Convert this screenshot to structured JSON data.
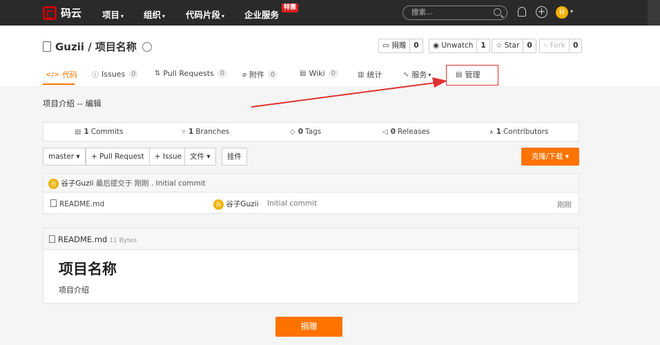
{
  "topnav": {
    "brand": "码云",
    "items": [
      {
        "label": "项目",
        "caret": "▾"
      },
      {
        "label": "组织",
        "caret": "▾"
      },
      {
        "label": "代码片段",
        "caret": "▾"
      },
      {
        "label": "企业服务",
        "caret": ""
      }
    ],
    "hot_badge": "特惠",
    "search_placeholder": "搜索...",
    "avatar_initial": "谷"
  },
  "repo": {
    "title": "Guzii / 项目名称",
    "actions": [
      {
        "label": "捐赠",
        "count": "0",
        "icon": "donate-icon"
      },
      {
        "label": "Unwatch",
        "count": "1",
        "icon": "eye-icon"
      },
      {
        "label": "Star",
        "count": "0",
        "icon": "star-icon"
      },
      {
        "label": "Fork",
        "count": "0",
        "icon": "fork-icon"
      }
    ],
    "tabs": [
      {
        "label": "代码",
        "icon": "</>",
        "count": ""
      },
      {
        "label": "Issues",
        "icon": "ⓘ",
        "count": "0"
      },
      {
        "label": "Pull Requests",
        "icon": "⇅",
        "count": "0"
      },
      {
        "label": "附件",
        "icon": "⌀",
        "count": "0"
      },
      {
        "label": "Wiki",
        "icon": "▤",
        "count": "0"
      },
      {
        "label": "统计",
        "icon": "▥",
        "count": ""
      },
      {
        "label": "服务",
        "icon": "∿",
        "count": ""
      },
      {
        "label": "管理",
        "icon": "▤",
        "count": ""
      }
    ]
  },
  "description": {
    "text": "项目介绍",
    "sep": " -- ",
    "edit": "编辑"
  },
  "stats": [
    {
      "count": "1",
      "label": "Commits",
      "icon": "▤"
    },
    {
      "count": "1",
      "label": "Branches",
      "icon": "⑂"
    },
    {
      "count": "0",
      "label": "Tags",
      "icon": "◇"
    },
    {
      "count": "0",
      "label": "Releases",
      "icon": "◁"
    },
    {
      "count": "1",
      "label": "Contributors",
      "icon": "⩚"
    }
  ],
  "toolbar": {
    "branch": "master ▾",
    "pull_request": "+ Pull Request",
    "issue": "+ Issue",
    "file": "文件 ▾",
    "widget": "挂件",
    "clone": "克隆/下载 ▾"
  },
  "commit": {
    "author": "谷子Guzii",
    "text": "最后提交于 刚刚 . Initial commit",
    "avatar_initial": "谷"
  },
  "files": [
    {
      "name": "README.md",
      "author": "谷子Guzii",
      "message": "Initial commit",
      "time": "刚刚"
    }
  ],
  "readme": {
    "file": "README.md",
    "size": "11 Bytes",
    "heading": "项目名称",
    "body": "项目介绍"
  },
  "donate_button": "捐赠",
  "colors": {
    "accent": "#fe7300",
    "nav_bg": "#2a2a2a",
    "annotation": "#e03030"
  }
}
